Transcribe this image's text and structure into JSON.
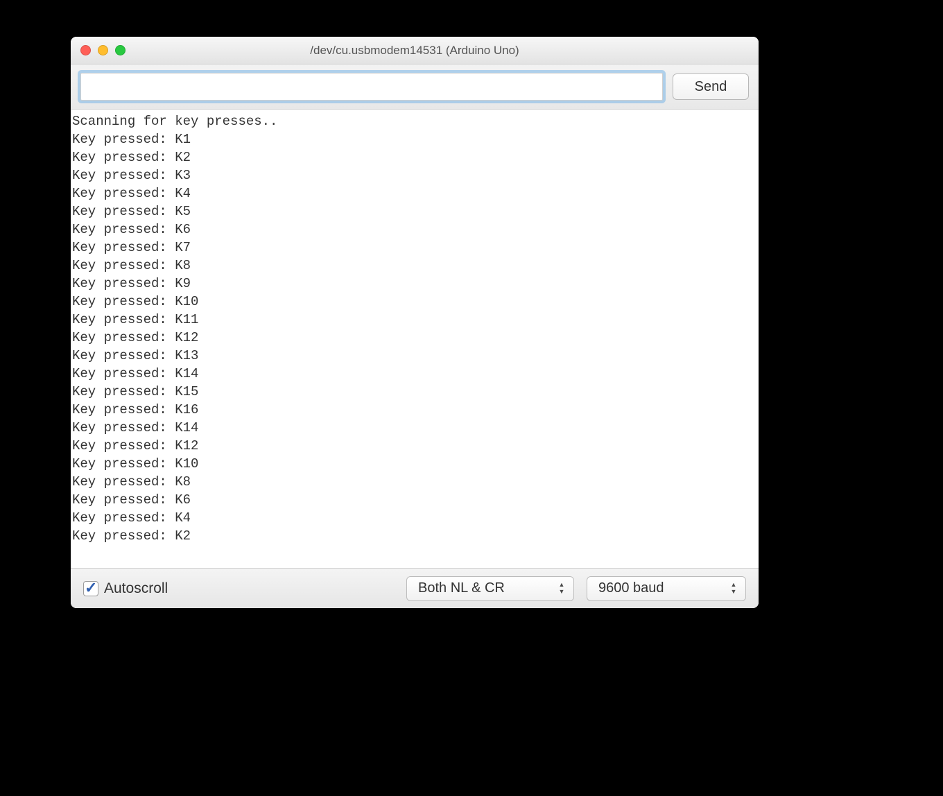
{
  "window": {
    "title": "/dev/cu.usbmodem14531 (Arduino Uno)"
  },
  "input": {
    "value": "",
    "send_label": "Send"
  },
  "output_lines": [
    "Scanning for key presses..",
    "Key pressed: K1",
    "Key pressed: K2",
    "Key pressed: K3",
    "Key pressed: K4",
    "Key pressed: K5",
    "Key pressed: K6",
    "Key pressed: K7",
    "Key pressed: K8",
    "Key pressed: K9",
    "Key pressed: K10",
    "Key pressed: K11",
    "Key pressed: K12",
    "Key pressed: K13",
    "Key pressed: K14",
    "Key pressed: K15",
    "Key pressed: K16",
    "Key pressed: K14",
    "Key pressed: K12",
    "Key pressed: K10",
    "Key pressed: K8",
    "Key pressed: K6",
    "Key pressed: K4",
    "Key pressed: K2"
  ],
  "footer": {
    "autoscroll_label": "Autoscroll",
    "autoscroll_checked": true,
    "line_ending_value": "Both NL & CR",
    "baud_value": "9600 baud"
  }
}
